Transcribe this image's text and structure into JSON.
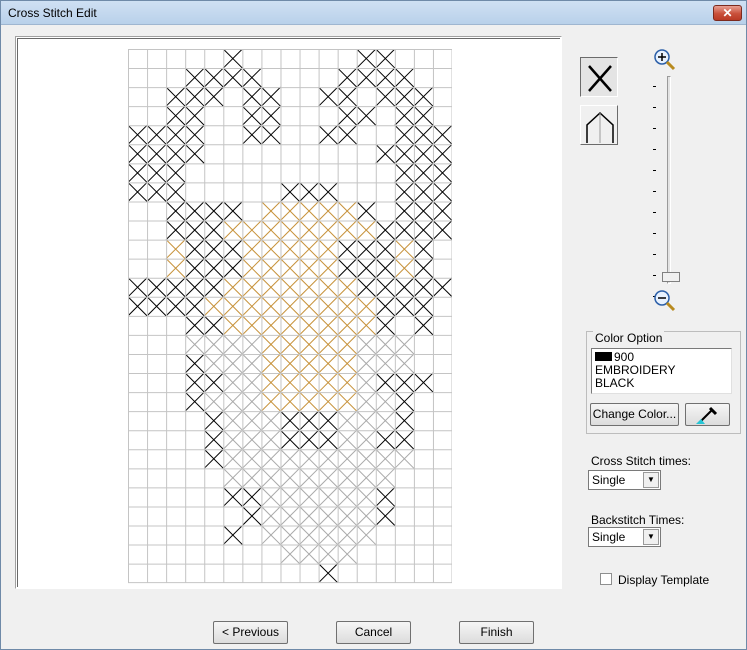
{
  "window": {
    "title": "Cross Stitch Edit",
    "close_glyph": "✕"
  },
  "pattern": {
    "rows": 28,
    "cols": 17,
    "colors": {
      "black": "#000000",
      "gold": "#c7923a",
      "gray": "#a9a9a9",
      "grid": "#c4c4c4"
    },
    "cells": [
      ".....B......BB...",
      "...BBBB....BBBB..",
      "..BBB.BB..BB.BBB.",
      "..BB..BB...BB.BB.",
      "BBBB..BB..BB..BBB",
      "BBBB.........BBBB",
      "BBB...........BBB",
      "BBB.....BBB...BBB",
      "..BBBB.GGGGGB.BBB",
      "..BBBGGGGGGGGBBBB",
      "..GBBBGGGGGBBBGB.",
      "..GBBBGGGGGBBBGB.",
      "BBBBBGGGGGGGBBBBB",
      "BBBBGGGGGGGGGBBB.",
      "...BBGGGGGGGGB.B.",
      "...SSSSGGGGGSSS..",
      "...BSSSGGGGGSSS..",
      "...BBSSGGGGGSBBB.",
      "...BSSSGGGGGSSB..",
      "....BSSSBBBSSSB..",
      "....BSSSBBBSSBB..",
      "....BSSSSSSSSSS..",
      ".....SSSSSSSSS...",
      ".....BBSSSSSSB...",
      "......BSSSSSSB...",
      ".....B.SSSSSS....",
      "........SSSS.....",
      "..........B......"
    ]
  },
  "tools": [
    {
      "name": "cross-stitch-tool",
      "icon": "cross-stitch-icon",
      "pressed": true
    },
    {
      "name": "backstitch-tool",
      "icon": "backstitch-icon",
      "pressed": false
    }
  ],
  "zoom": {
    "in_icon": "zoom-in-icon",
    "out_icon": "zoom-out-icon",
    "tick_count": 11,
    "level": 0.0
  },
  "color_option": {
    "label": "Color Option",
    "swatch_color": "#000000",
    "line1": "900",
    "line2": "EMBROIDERY",
    "line3": "BLACK",
    "change_button": "Change Color...",
    "picker_icon": "eyedropper-icon"
  },
  "cross_stitch": {
    "label": "Cross Stitch times:",
    "value": "Single"
  },
  "backstitch": {
    "label": "Backstitch Times:",
    "value": "Single"
  },
  "template": {
    "label": "Display Template",
    "checked": false
  },
  "footer": {
    "previous": "< Previous",
    "cancel": "Cancel",
    "finish": "Finish"
  }
}
